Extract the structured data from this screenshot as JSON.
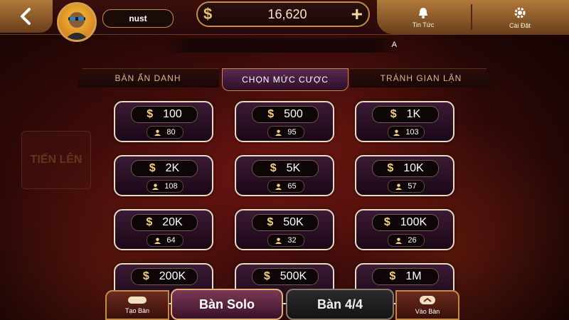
{
  "header": {
    "username": "nust",
    "balance": "16,620",
    "currency_symbol": "$",
    "plus_symbol": "+",
    "news_label": "Tin Tức",
    "settings_label": "Cài Đặt",
    "marquee_text": "A"
  },
  "tabs": [
    {
      "label": "BÀN ẨN DANH",
      "active": false
    },
    {
      "label": "CHỌN MỨC CƯỢC",
      "active": true
    },
    {
      "label": "TRÁNH GIAN LẬN",
      "active": false
    }
  ],
  "side_logo": {
    "text": "TIẾN LÊN"
  },
  "bets": [
    {
      "amount": "100",
      "players": "80"
    },
    {
      "amount": "500",
      "players": "95"
    },
    {
      "amount": "1K",
      "players": "103"
    },
    {
      "amount": "2K",
      "players": "108"
    },
    {
      "amount": "5K",
      "players": "65"
    },
    {
      "amount": "10K",
      "players": "57"
    },
    {
      "amount": "20K",
      "players": "64"
    },
    {
      "amount": "50K",
      "players": "32"
    },
    {
      "amount": "100K",
      "players": "26"
    },
    {
      "amount": "200K",
      "players": ""
    },
    {
      "amount": "500K",
      "players": ""
    },
    {
      "amount": "1M",
      "players": ""
    }
  ],
  "bottom": {
    "create_label": "Tạo Bàn",
    "solo_label": "Bàn Solo",
    "four_label": "Bàn 4/4",
    "join_label": "Vào Bàn"
  },
  "colors": {
    "gold": "#c48a4a",
    "accent_purple": "#5a2a50",
    "background": "#3d0b09"
  }
}
